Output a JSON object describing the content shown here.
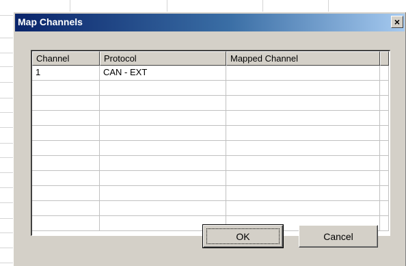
{
  "dialog": {
    "title": "Map Channels",
    "close_glyph": "×",
    "close_icon": "close-icon"
  },
  "table": {
    "headers": [
      "Channel",
      "Protocol",
      "Mapped Channel",
      ""
    ],
    "rows": [
      [
        "1",
        "CAN - EXT",
        "",
        ""
      ],
      [
        "",
        "",
        "",
        ""
      ],
      [
        "",
        "",
        "",
        ""
      ],
      [
        "",
        "",
        "",
        ""
      ],
      [
        "",
        "",
        "",
        ""
      ],
      [
        "",
        "",
        "",
        ""
      ],
      [
        "",
        "",
        "",
        ""
      ],
      [
        "",
        "",
        "",
        ""
      ],
      [
        "",
        "",
        "",
        ""
      ],
      [
        "",
        "",
        "",
        ""
      ],
      [
        "",
        "",
        "",
        ""
      ]
    ]
  },
  "buttons": {
    "ok_label": "OK",
    "cancel_label": "Cancel"
  },
  "colors": {
    "titlebar_start": "#0a246a",
    "titlebar_end": "#a6caf0",
    "face": "#d4d0c8"
  }
}
